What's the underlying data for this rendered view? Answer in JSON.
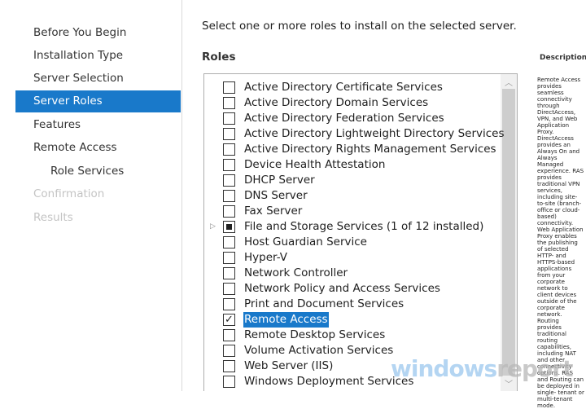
{
  "nav": [
    "Before You Begin",
    "Installation Type",
    "Server Selection",
    "Server Roles",
    "Features",
    "Remote Access",
    "Role Services",
    "Confirmation",
    "Results"
  ],
  "intro": "Select one or more roles to install on the selected server.",
  "roles_header": "Roles",
  "description_header": "Description",
  "roles": [
    {
      "label": "Active Directory Certificate Services",
      "state": "unchecked"
    },
    {
      "label": "Active Directory Domain Services",
      "state": "unchecked"
    },
    {
      "label": "Active Directory Federation Services",
      "state": "unchecked"
    },
    {
      "label": "Active Directory Lightweight Directory Services",
      "state": "unchecked"
    },
    {
      "label": "Active Directory Rights Management Services",
      "state": "unchecked"
    },
    {
      "label": "Device Health Attestation",
      "state": "unchecked"
    },
    {
      "label": "DHCP Server",
      "state": "unchecked"
    },
    {
      "label": "DNS Server",
      "state": "unchecked"
    },
    {
      "label": "Fax Server",
      "state": "unchecked"
    },
    {
      "label": "File and Storage Services (1 of 12 installed)",
      "state": "partial"
    },
    {
      "label": "Host Guardian Service",
      "state": "unchecked"
    },
    {
      "label": "Hyper-V",
      "state": "unchecked"
    },
    {
      "label": "Network Controller",
      "state": "unchecked"
    },
    {
      "label": "Network Policy and Access Services",
      "state": "unchecked"
    },
    {
      "label": "Print and Document Services",
      "state": "unchecked"
    },
    {
      "label": "Remote Access",
      "state": "checked"
    },
    {
      "label": "Remote Desktop Services",
      "state": "unchecked"
    },
    {
      "label": "Volume Activation Services",
      "state": "unchecked"
    },
    {
      "label": "Web Server (IIS)",
      "state": "unchecked"
    },
    {
      "label": "Windows Deployment Services",
      "state": "unchecked"
    }
  ],
  "description_lines": [
    "Remote Access provides seamless",
    "connectivity through DirectAccess,",
    "VPN, and Web Application Proxy.",
    "DirectAccess provides an Always On",
    "and Always Managed experience.",
    "RAS provides traditional VPN",
    "services, including site-to-site",
    "(branch-office or cloud-based)",
    "connectivity. Web Application Proxy",
    "enables the publishing of selected",
    "HTTP- and HTTPS-based",
    "applications from your corporate",
    "network to client devices outside of",
    "the corporate network. Routing",
    "provides traditional routing",
    "capabilities, including NAT and other",
    "connectivity options. RAS and",
    "Routing can be deployed in single-",
    "tenant or multi-tenant mode."
  ],
  "watermark": {
    "part1": "windows",
    "part2": "report"
  }
}
